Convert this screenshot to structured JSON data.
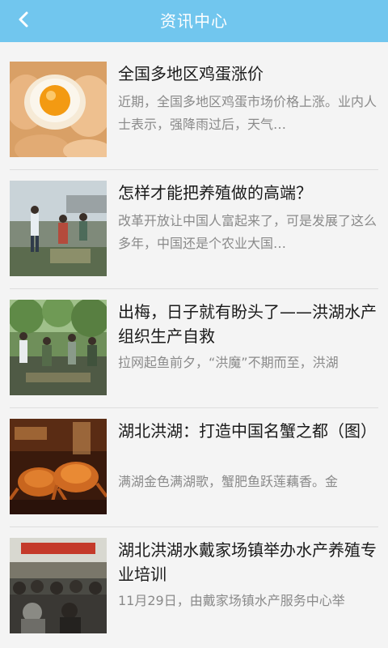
{
  "header": {
    "title": "资讯中心",
    "back_icon": "chevron-left-icon",
    "background_color": "#71c6ee"
  },
  "news": [
    {
      "title": "全国多地区鸡蛋涨价",
      "summary": "近期，全国多地区鸡蛋市场价格上涨。业内人士表示，强降雨过后，天气…",
      "image": "eggs-photo"
    },
    {
      "title": "怎样才能把养殖做的高端？",
      "summary": "改革开放让中国人富起来了，可是发展了这么多年，中国还是个农业大国…",
      "image": "fish-farming-photo"
    },
    {
      "title": "出梅，日子就有盼头了——洪湖水产组织生产自救",
      "summary": "拉网起鱼前夕，“洪魔”不期而至，洪湖",
      "image": "fishing-net-photo"
    },
    {
      "title": "湖北洪湖：打造中国名蟹之都（图）",
      "summary": "满湖金色满湖歌，蟹肥鱼跃莲藕香。金",
      "image": "crab-photo"
    },
    {
      "title": "湖北洪湖水戴家场镇举办水产养殖专业培训",
      "summary": "11月29日，由戴家场镇水产服务中心举",
      "image": "training-meeting-photo"
    }
  ]
}
